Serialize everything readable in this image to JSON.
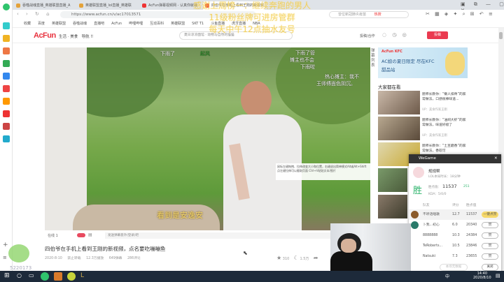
{
  "browser": {
    "tabs": [
      "吞噬战魂直播_英雄联盟直播_A",
      "英雄联盟直播_lol直播_英雄联",
      "AcFun弹幕视频网 - 认真你就输",
      "四伯爷在手机上看到王刚的新视频"
    ],
    "url": "https://www.acfun.cn/v/ac17013571",
    "search_placeholder": "曾位新冠肺炎疫苗",
    "search_hot": "热搜",
    "bookmarks": [
      "收藏",
      "百度",
      "英雄联盟",
      "吞噬战魂",
      "直播吧",
      "AcFun",
      "哔哩哔哩",
      "互动百科",
      "英雄联盟",
      "SKT T1",
      "斗鱼直播",
      "虎牙直播",
      "NBA"
    ]
  },
  "site": {
    "logo": "AcFun",
    "nav": [
      "生活 · 美食",
      "导航"
    ],
    "search_placeholder": "夏日凉凉面馆 · 动物与自然的猫猫",
    "header_link": "投稿/合作",
    "upload_label": "投稿"
  },
  "video": {
    "danmaku": [
      "下雨了",
      "起风",
      "下雨了管",
      "摊主也不会",
      "下雨啦",
      "热心摊主：我不",
      "王师傅面色阴沉。"
    ],
    "subtitle": "看到是安逸安",
    "tooltip": "鼠标左键拖拽、拉伸改变大小和位置，右键退出简单模式Alt或Alt+Shift点左键拉伸可以截取页面 Ctrl+V粘贴文本/图片",
    "online": "在线 1",
    "danmaku_placeholder": "发送弹幕意外(登录)吧",
    "title": "四伯爷在手机上看到王刚的新视频，点名要吃嘣嘣鱼",
    "meta": [
      "2020-8-10",
      "禁止转载",
      "12.3万播放",
      "649弹幕",
      "286评论"
    ],
    "likes": "310",
    "bananas": "1.5万"
  },
  "sidebar": {
    "danmaku_list_label": "弹幕列表",
    "ad_text": "AC娘の夏日限定 尽在KFC甜品站",
    "section_title": "大家都在看",
    "recs": [
      {
        "title": "厨师长教你：“懒人排骨”的家常做法，口感很棒味道...",
        "up": "UP：美食作家王刚"
      },
      {
        "title": "厨师长教你：“油焖大虾”的家常做法，味道好极了",
        "up": "UP：美食作家王刚"
      },
      {
        "title": "厨师长教你：“土豆磨香”的家常做法，香软可",
        "up": "UP：美食作家王刚"
      }
    ]
  },
  "wegame": {
    "title": "WeGame",
    "player": "规规帮",
    "sub": "LOL本局时长：18分钟",
    "result": "胜",
    "score_label": "胜点值：",
    "score": "11537",
    "delta": "251",
    "kda": "KDA：5/0/0",
    "headers": [
      "队友",
      "评分",
      "胜点值"
    ],
    "rows": [
      {
        "name": "不听话唱歌",
        "rate": "12.7",
        "pts": "11537",
        "btn": "一键点赞"
      },
      {
        "name": "卜我...初心",
        "rate": "6.0",
        "pts": "20340",
        "btn": "赞"
      },
      {
        "name": "8888888",
        "rate": "10.3",
        "pts": "24384",
        "btn": "赞"
      },
      {
        "name": "TeRoberts...",
        "rate": "10.5",
        "pts": "23846",
        "btn": "赞"
      },
      {
        "name": "Natsuki",
        "rate": "7.3",
        "pts": "23655",
        "btn": "赞"
      }
    ],
    "footer_mid": "本场无数据",
    "close": "关闭"
  },
  "overlay": [
    "感谢上周榜一：继续奔跑的男人",
    "11级粉丝牌可进房管群",
    "每天中午12点抽水友号"
  ],
  "counter": "5220173",
  "taskbar": {
    "time": "14:40",
    "date": "2020/8/10",
    "ime": "中"
  }
}
